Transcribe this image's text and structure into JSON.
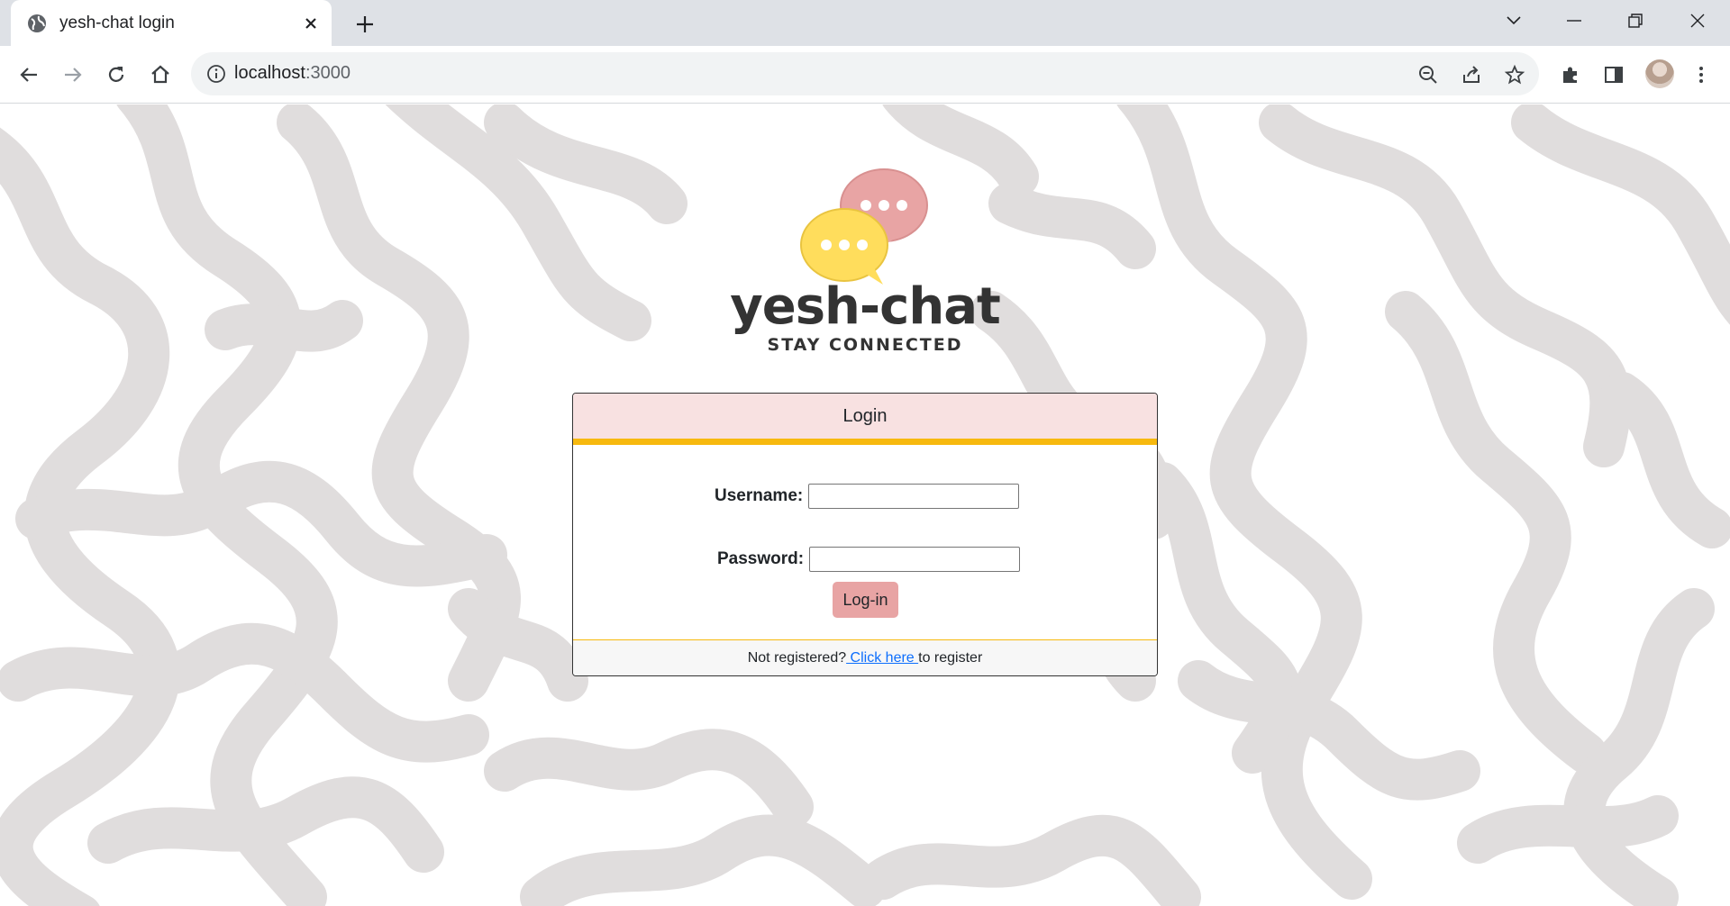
{
  "browser": {
    "tab_title": "yesh-chat login",
    "url_host": "localhost",
    "url_port": ":3000"
  },
  "page": {
    "brand": "yesh-chat",
    "tagline": "STAY CONNECTED",
    "login": {
      "header": "Login",
      "username_label": "Username:",
      "username_value": "",
      "password_label": "Password:",
      "password_value": "",
      "submit_label": "Log-in",
      "footer_prefix": "Not registered?",
      "footer_link": " Click here ",
      "footer_suffix": "to register"
    }
  },
  "colors": {
    "header_bg": "#f8e1e1",
    "accent_yellow": "#f7b90e",
    "button_pink": "#e8a4a4",
    "bubble_pink": "#e8a4a4",
    "bubble_yellow": "#ffdd5c",
    "pattern": "#e0dddd"
  }
}
